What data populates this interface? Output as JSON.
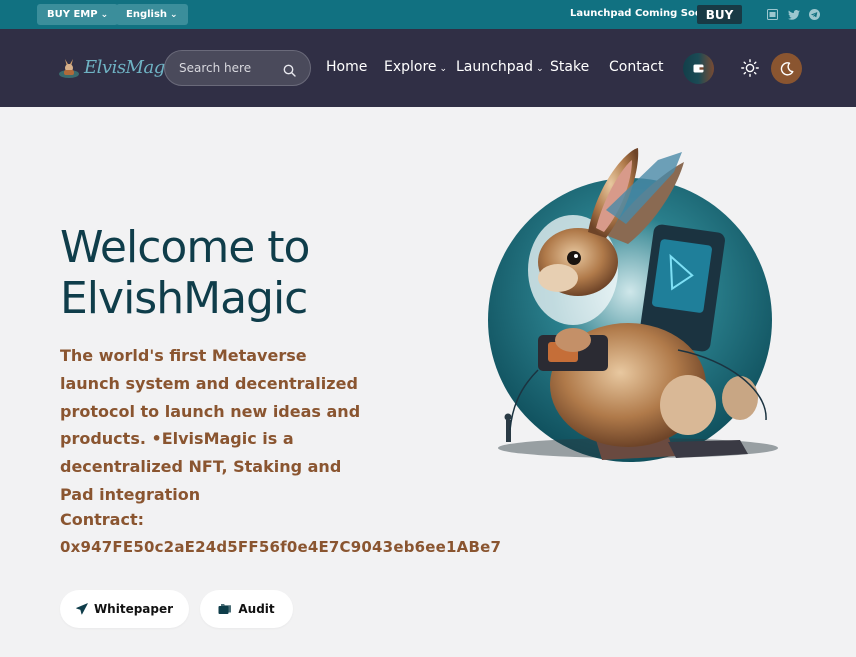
{
  "topbar": {
    "buy_emp_label": "BUY EMP",
    "language_label": "English",
    "announcement": "Launchpad Coming Soon",
    "buy_label": "BUY",
    "social_icons": [
      "medium-icon",
      "twitter-icon",
      "telegram-icon"
    ]
  },
  "nav": {
    "logo_text": "ElvisMagic",
    "search_placeholder": "Search here",
    "links": [
      {
        "label": "Home",
        "has_dropdown": false
      },
      {
        "label": "Explore",
        "has_dropdown": true
      },
      {
        "label": "Launchpad",
        "has_dropdown": true
      },
      {
        "label": "Stake",
        "has_dropdown": false
      },
      {
        "label": "Contact",
        "has_dropdown": false
      }
    ],
    "wallet_icon": "wallet-icon",
    "theme_light_icon": "sun-icon",
    "theme_dark_icon": "moon-icon"
  },
  "hero": {
    "title_line1": "Welcome to",
    "title_line2": "ElvishMagic",
    "description": "The world's first Metaverse launch system and decentralized protocol to launch new ideas and products. •ElvisMagic is a decentralized NFT, Staking and Pad integration",
    "contract_label": "Contract:",
    "contract_address": "0x947FE50c2aE24d5FF56f0e4E7C9043eb6ee1ABe7",
    "whitepaper_label": "Whitepaper",
    "audit_label": "Audit",
    "image_subject": "rabbit-with-tablet-illustration"
  },
  "colors": {
    "topbar_bg": "#117181",
    "nav_bg": "#302f45",
    "page_bg": "#f2f2f3",
    "title_color": "#0f3d4a",
    "accent_brown": "#8a5530",
    "buy_bg": "#183a45"
  }
}
